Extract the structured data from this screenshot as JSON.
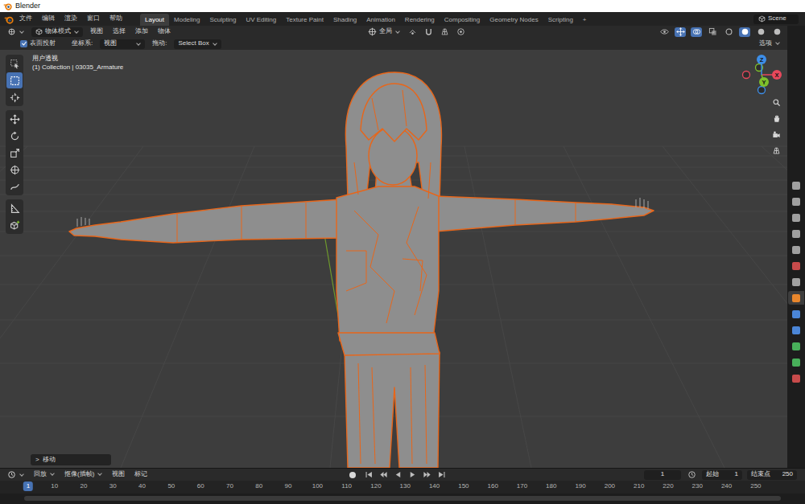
{
  "window": {
    "title": "Blender"
  },
  "menu": [
    "文件",
    "编辑",
    "渲染",
    "窗口",
    "帮助"
  ],
  "workspaces": [
    {
      "label": "Layout",
      "selected": true
    },
    {
      "label": "Modeling",
      "selected": false
    },
    {
      "label": "Sculpting",
      "selected": false
    },
    {
      "label": "UV Editing",
      "selected": false
    },
    {
      "label": "Texture Paint",
      "selected": false
    },
    {
      "label": "Shading",
      "selected": false
    },
    {
      "label": "Animation",
      "selected": false
    },
    {
      "label": "Rendering",
      "selected": false
    },
    {
      "label": "Compositing",
      "selected": false
    },
    {
      "label": "Geometry Nodes",
      "selected": false
    },
    {
      "label": "Scripting",
      "selected": false
    }
  ],
  "add_workspace": "+",
  "scene": "Scene",
  "header": {
    "mode": "物体模式",
    "menus": [
      "视图",
      "选择",
      "添加",
      "物体"
    ],
    "orientation": "全局"
  },
  "tool_settings": {
    "surface_project": {
      "label": "表面投射",
      "checked": true
    },
    "orientation_label": "坐标系:",
    "orientation": "视图",
    "drag_label": "拖动:",
    "drag": "Select Box",
    "options": "选项"
  },
  "viewport": {
    "view_name": "用户透视",
    "collection": "(1) Collection | 03035_Armature",
    "tools": [
      {
        "kind": "tweak",
        "selected": false
      },
      {
        "kind": "select",
        "selected": true
      },
      {
        "kind": "cursor",
        "selected": false
      },
      {
        "kind": "move",
        "selected": false
      },
      {
        "kind": "rotate",
        "selected": false
      },
      {
        "kind": "scale",
        "selected": false
      },
      {
        "kind": "transform",
        "selected": false
      },
      {
        "kind": "annotate",
        "selected": false
      },
      {
        "kind": "measure",
        "selected": false
      },
      {
        "kind": "add",
        "selected": false
      }
    ],
    "gizmo": [
      {
        "label": "X",
        "color": "#e8485c"
      },
      {
        "label": "Y",
        "color": "#7ec02c"
      },
      {
        "label": "Z",
        "color": "#3d8ee8"
      }
    ]
  },
  "last_operator": {
    "arrow": ">",
    "label": "移动"
  },
  "properties_tabs": [
    {
      "color": "#a0a0a0",
      "selected": false
    },
    {
      "color": "#a0a0a0",
      "selected": false
    },
    {
      "color": "#a0a0a0",
      "selected": false
    },
    {
      "color": "#a0a0a0",
      "selected": false
    },
    {
      "color": "#a0a0a0",
      "selected": false
    },
    {
      "color": "#c84b4b",
      "selected": false
    },
    {
      "color": "#a0a0a0",
      "selected": false
    },
    {
      "color": "#e8862c",
      "selected": true
    },
    {
      "color": "#4b86d8",
      "selected": false
    },
    {
      "color": "#4b86d8",
      "selected": false
    },
    {
      "color": "#48b05a",
      "selected": false
    },
    {
      "color": "#48b05a",
      "selected": false
    },
    {
      "color": "#c84b4b",
      "selected": false
    }
  ],
  "timeline": {
    "menus": [
      {
        "label": "回放",
        "kind": "dropdown"
      },
      {
        "label": "抠像(插帧)",
        "kind": "dropdown"
      },
      {
        "label": "视图",
        "kind": "menu"
      },
      {
        "label": "标记",
        "kind": "menu"
      }
    ],
    "current_frame": "1",
    "start_label": "起始",
    "start": "1",
    "end_label": "结束点",
    "end": "250",
    "playhead": "1",
    "ticks": [
      "10",
      "20",
      "30",
      "40",
      "50",
      "60",
      "70",
      "80",
      "90",
      "100",
      "110",
      "120",
      "130",
      "140",
      "150",
      "160",
      "170",
      "180",
      "190",
      "200",
      "210",
      "220",
      "230",
      "240",
      "250"
    ]
  }
}
